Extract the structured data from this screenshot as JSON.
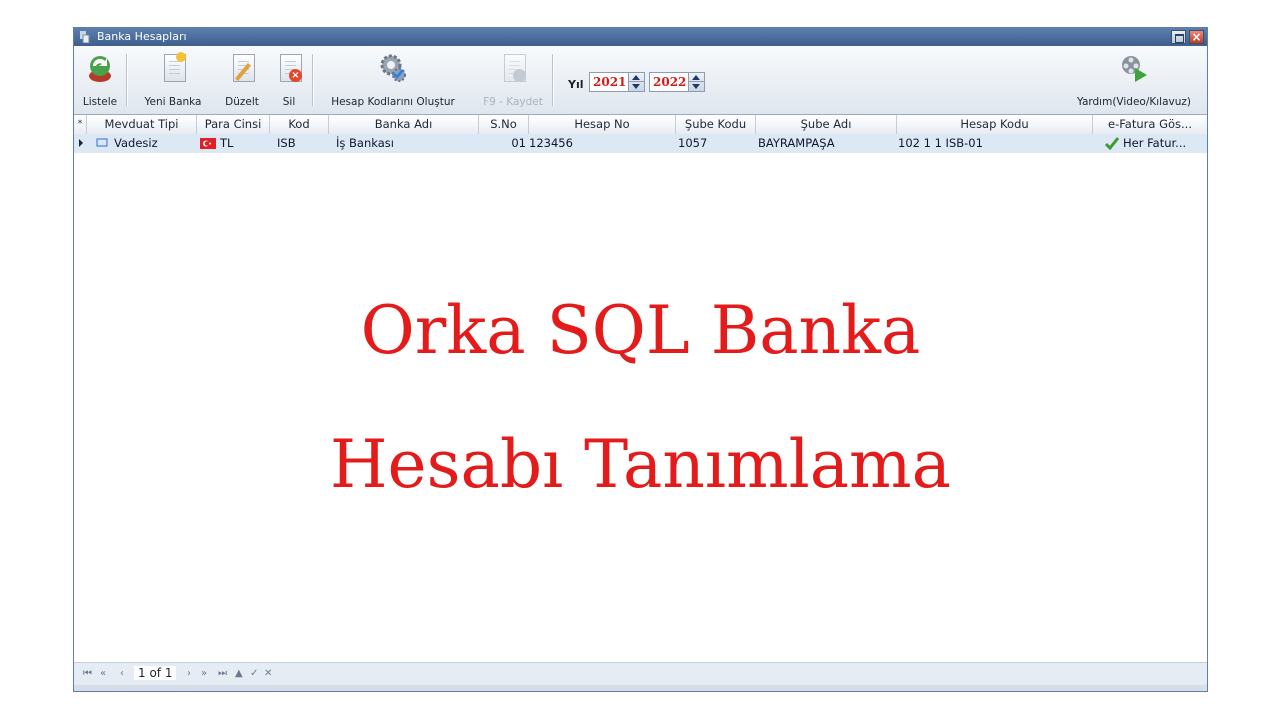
{
  "window": {
    "title": "Banka Hesapları"
  },
  "toolbar": {
    "listele": "Listele",
    "yeni_banka": "Yeni Banka",
    "duzelt": "Düzelt",
    "sil": "Sil",
    "hesap_kodlari": "Hesap Kodlarını Oluştur",
    "kaydet": "F9 - Kaydet",
    "yil_label": "Yıl",
    "year_from": "2021",
    "year_to": "2022",
    "yardim": "Yardım(Video/Kılavuz)"
  },
  "columns": [
    "Mevduat Tipi",
    "Para Cinsi",
    "Kod",
    "Banka Adı",
    "S.No",
    "Hesap No",
    "Şube Kodu",
    "Şube Adı",
    "Hesap Kodu",
    "e-Fatura Gös..."
  ],
  "row_marker": "*",
  "rows": [
    [
      "Vadesiz",
      "TL",
      "ISB",
      "İş Bankası",
      "01",
      "123456",
      "1057",
      "BAYRAMPAŞA",
      "102 1 1 ISB-01",
      "Her Fatur..."
    ]
  ],
  "overlay": {
    "line1": "Orka SQL Banka",
    "line2": "Hesabı Tanımlama"
  },
  "navigator": {
    "first": "⏮",
    "prev_page": "«",
    "prev": "‹",
    "position": "1 of 1",
    "next": "›",
    "next_page": "»",
    "last": "⏭",
    "up": "▲",
    "check": "✓",
    "cancel": "✕"
  },
  "colors": {
    "accent_red": "#e31b1b",
    "title_blue": "#4a6c9c",
    "row_selected": "#dde8f5"
  }
}
